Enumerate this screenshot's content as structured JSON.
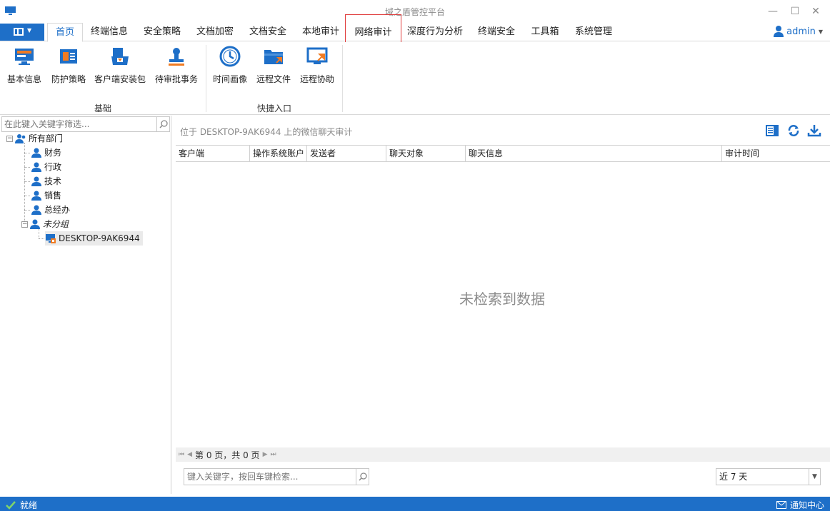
{
  "window": {
    "title": "域之盾管控平台"
  },
  "tabs": [
    {
      "label": "首页"
    },
    {
      "label": "终端信息"
    },
    {
      "label": "安全策略"
    },
    {
      "label": "文档加密"
    },
    {
      "label": "文档安全"
    },
    {
      "label": "本地审计"
    },
    {
      "label": "网络审计"
    },
    {
      "label": "深度行为分析"
    },
    {
      "label": "终端安全"
    },
    {
      "label": "工具箱"
    },
    {
      "label": "系统管理"
    }
  ],
  "user": {
    "name": "admin"
  },
  "ribbon": {
    "groups": [
      {
        "label": "基础",
        "buttons": [
          {
            "label": "基本信息",
            "icon": "monitor-icon"
          },
          {
            "label": "防护策略",
            "icon": "id-card-icon"
          },
          {
            "label": "客户端安装包",
            "icon": "package-icon"
          },
          {
            "label": "待审批事务",
            "icon": "stamp-icon"
          }
        ]
      },
      {
        "label": "快捷入口",
        "buttons": [
          {
            "label": "时间画像",
            "icon": "clock-icon"
          },
          {
            "label": "远程文件",
            "icon": "folder-icon"
          },
          {
            "label": "远程协助",
            "icon": "remote-screen-icon"
          }
        ]
      }
    ]
  },
  "tree": {
    "search_placeholder": "在此键入关键字筛选...",
    "root": "所有部门",
    "departments": [
      "财务",
      "行政",
      "技术",
      "销售",
      "总经办",
      "未分组"
    ],
    "device": "DESKTOP-9AK6944"
  },
  "main": {
    "location": "位于 DESKTOP-9AK6944 上的微信聊天审计",
    "columns": [
      "客户端",
      "操作系统账户",
      "发送者",
      "聊天对象",
      "聊天信息",
      "审计时间"
    ],
    "empty_message": "未检索到数据",
    "pager_text": "第 0 页，共 0 页",
    "search_placeholder": "键入关键字，按回车键检索...",
    "period": "近 7 天"
  },
  "status": {
    "ready": "就绪",
    "notify": "通知中心"
  },
  "colors": {
    "accent": "#1e6fc8",
    "highlight": "#e03c3c",
    "orange": "#f07b22"
  }
}
